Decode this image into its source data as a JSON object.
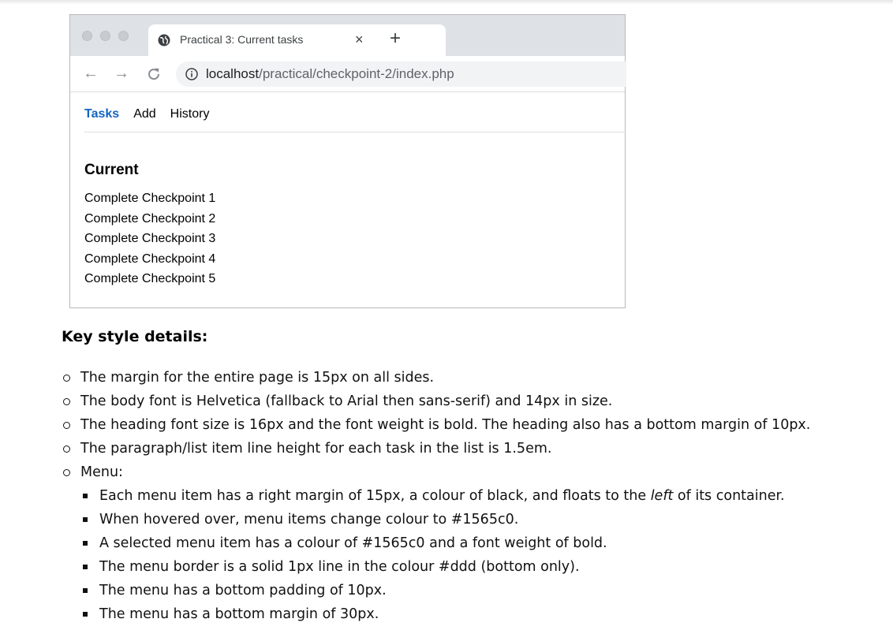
{
  "browser": {
    "tab_title": "Practical 3: Current tasks",
    "tab_close": "×",
    "new_tab": "+",
    "nav": {
      "back": "←",
      "forward": "→",
      "reload": "C"
    },
    "url_host": "localhost",
    "url_path": "/practical/checkpoint-2/index.php"
  },
  "page": {
    "menu": [
      {
        "label": "Tasks",
        "selected": true
      },
      {
        "label": "Add",
        "selected": false
      },
      {
        "label": "History",
        "selected": false
      }
    ],
    "heading": "Current",
    "tasks": [
      "Complete Checkpoint 1",
      "Complete Checkpoint 2",
      "Complete Checkpoint 3",
      "Complete Checkpoint 4",
      "Complete Checkpoint 5"
    ]
  },
  "doc": {
    "title": "Key style details:",
    "items": [
      "The margin for the entire page is 15px on all sides.",
      "The body font is Helvetica (fallback to Arial then sans-serif) and 14px in size.",
      "The heading font size is 16px and the font weight is bold. The heading also has a bottom margin of 10px.",
      "The paragraph/list item line height for each task in the list is 1.5em.",
      "Menu:"
    ],
    "menu_item_pre": "Each menu item has a right margin of 15px, a colour of black, and floats to the ",
    "menu_item_em": "left",
    "menu_item_post": " of its container.",
    "sub_items": [
      "When hovered over, menu items change colour to #1565c0.",
      "A selected menu item has a colour of #1565c0 and a font weight of bold.",
      "The menu border is a solid 1px line in the colour #ddd (bottom only).",
      "The menu has a bottom padding of 10px.",
      "The menu has a bottom margin of 30px."
    ]
  },
  "colors": {
    "accent": "#1565c0",
    "menu_border": "#dddddd"
  }
}
